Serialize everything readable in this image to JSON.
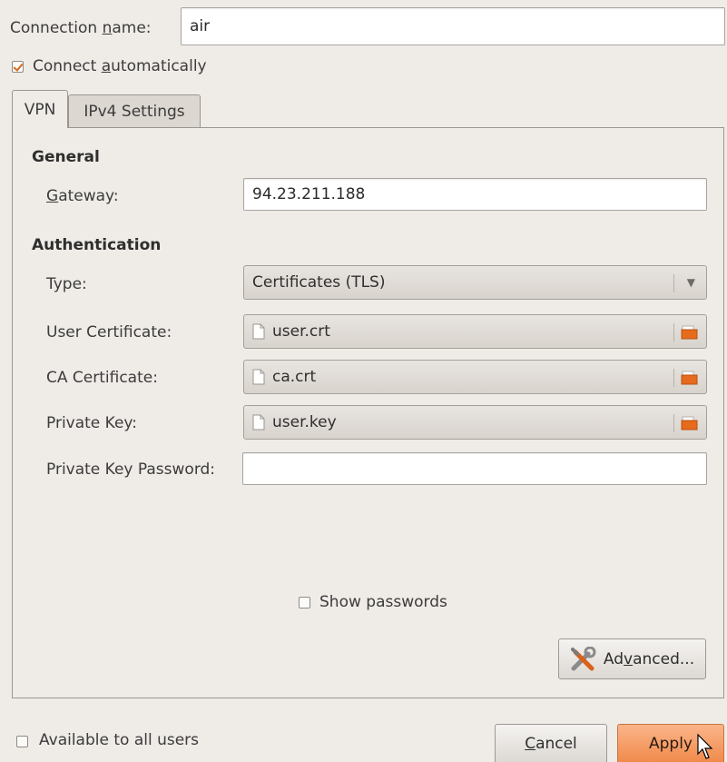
{
  "connection": {
    "name_label_prefix": "Connection ",
    "name_label_mnemonic": "n",
    "name_label_suffix": "ame:",
    "name_value": "air",
    "autoconnect_prefix": "Connect ",
    "autoconnect_mnemonic": "a",
    "autoconnect_suffix": "utomatically",
    "autoconnect_checked": true
  },
  "tabs": [
    {
      "label": "VPN",
      "active": true
    },
    {
      "label": "IPv4 Settings",
      "active": false
    }
  ],
  "general": {
    "heading": "General",
    "gateway_mnemonic": "G",
    "gateway_label_rest": "ateway:",
    "gateway_value": "94.23.211.188"
  },
  "auth": {
    "heading": "Authentication",
    "type_label": "Type:",
    "type_value": "Certificates (TLS)",
    "user_cert_label": "User Certificate:",
    "user_cert_value": "user.crt",
    "ca_cert_label": "CA Certificate:",
    "ca_cert_value": "ca.crt",
    "private_key_label": "Private Key:",
    "private_key_value": "user.key",
    "key_password_label": "Private Key Password:",
    "key_password_value": ""
  },
  "show_passwords": {
    "label": "Show passwords",
    "checked": false
  },
  "advanced_button": {
    "prefix": "Ad",
    "mnemonic": "v",
    "suffix": "anced..."
  },
  "available_all_users": {
    "label": "Available to all users",
    "checked": false
  },
  "footer": {
    "cancel_mnemonic": "C",
    "cancel_rest": "ancel",
    "apply_label": "Apply"
  },
  "colors": {
    "accent": "#f08a4b",
    "background": "#efebe7"
  }
}
